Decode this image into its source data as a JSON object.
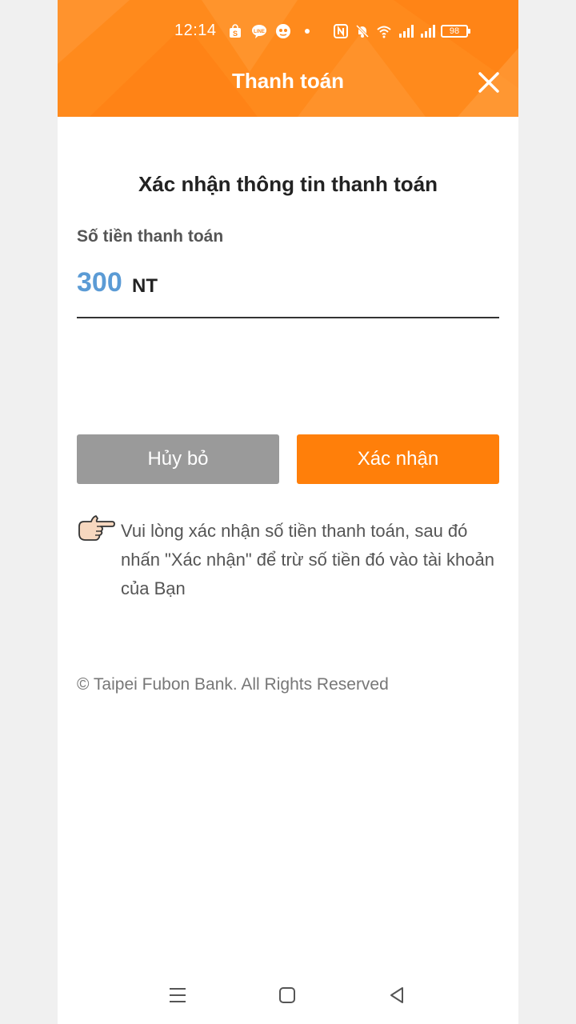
{
  "status_bar": {
    "time": "12:14",
    "battery": "98",
    "icons_left": [
      "shopee-icon",
      "line-icon",
      "messenger-icon",
      "dot-icon"
    ],
    "icons_right": [
      "nfc-icon",
      "mute-icon",
      "wifi-icon",
      "signal-icon",
      "signal-icon"
    ]
  },
  "header": {
    "title": "Thanh toán",
    "close_icon": "close-icon",
    "background_color": "#ff8a1c"
  },
  "main": {
    "section_title": "Xác nhận thông tin thanh toán",
    "amount_label": "Số tiền thanh toán",
    "amount_value": "300",
    "amount_unit": "NT",
    "amount_color": "#5b9bd5"
  },
  "buttons": {
    "cancel_label": "Hủy bỏ",
    "confirm_label": "Xác nhận",
    "cancel_color": "#9a9a9a",
    "confirm_color": "#ff7f0a"
  },
  "hint": {
    "icon": "pointing-hand-icon",
    "text": "Vui lòng xác nhận số tiền thanh toán, sau đó nhấn \"Xác nhận\" để trừ số tiền đó vào tài khoản của Bạn"
  },
  "footer": {
    "copyright": "© Taipei Fubon Bank. All Rights Reserved"
  },
  "nav_bar": {
    "items": [
      "menu-icon",
      "home-icon",
      "back-icon"
    ]
  }
}
